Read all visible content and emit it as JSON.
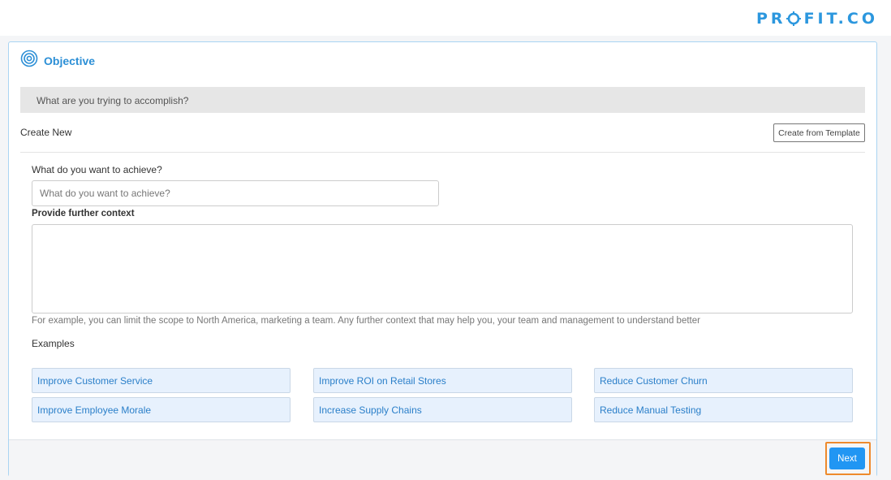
{
  "brand": {
    "logo_left": "PR",
    "logo_right": "FIT.CO",
    "color": "#2c97de"
  },
  "card": {
    "title": "Objective",
    "title_icon": "target-icon",
    "banner_text": "What are you trying to accomplish?",
    "create_new_label": "Create New",
    "template_button_label": "Create from Template"
  },
  "form": {
    "achieve_label": "What do you want to achieve?",
    "achieve_placeholder": "What do you want to achieve?",
    "achieve_value": "",
    "context_label": "Provide further context",
    "context_value": "",
    "hint": "For example, you can limit the scope to North America, marketing a team. Any further context that may help you, your team and management to understand better"
  },
  "examples": {
    "label": "Examples",
    "items": [
      "Improve Customer Service",
      "Improve ROI on Retail Stores",
      "Reduce Customer Churn",
      "Improve Employee Morale",
      "Increase Supply Chains",
      "Reduce Manual Testing"
    ]
  },
  "footer": {
    "next_label": "Next",
    "highlight_color": "#ee8a2c",
    "accent_color": "#2196f3"
  }
}
